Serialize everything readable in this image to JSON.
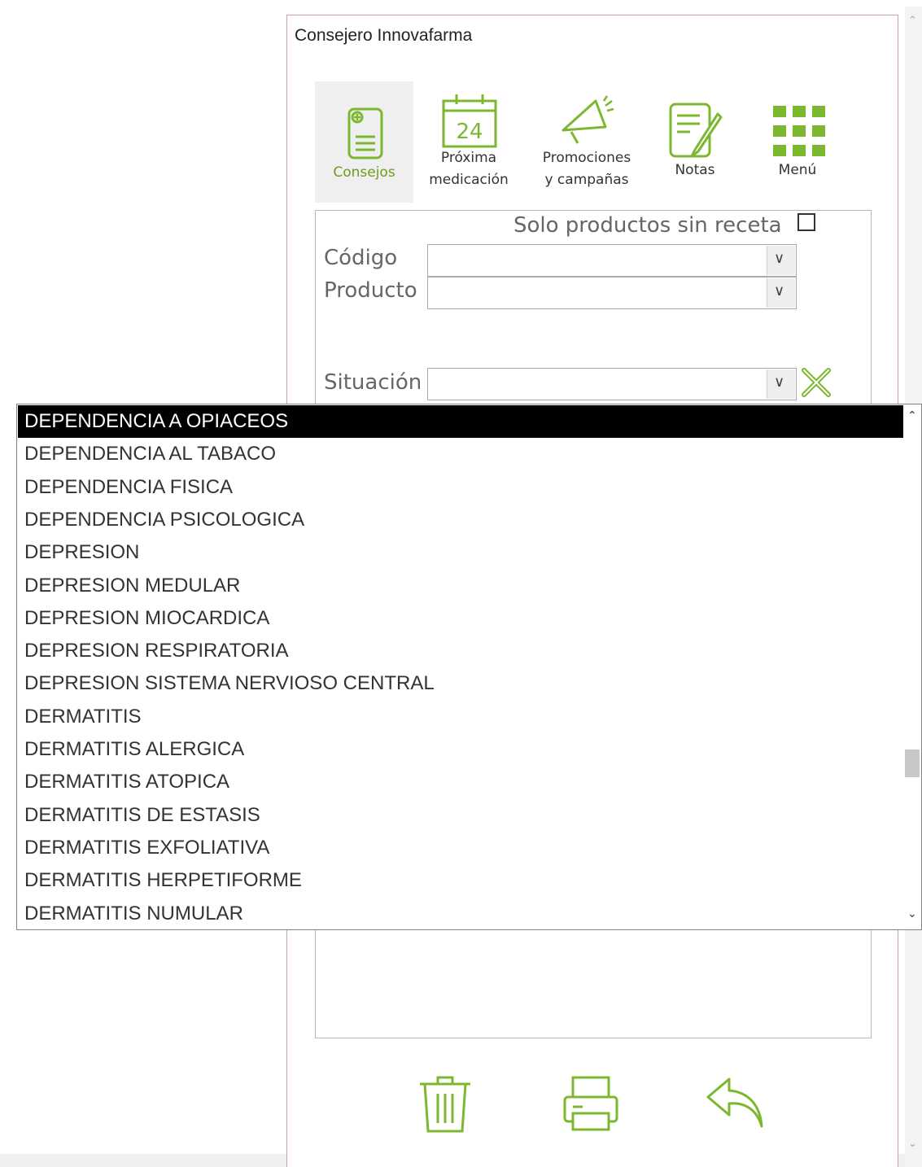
{
  "window": {
    "title": "Consejero Innovafarma"
  },
  "toolbar": {
    "consejos": "Consejos",
    "proxima_line1": "Próxima",
    "proxima_line2": "medicación",
    "calendar_day": "24",
    "promo_line1": "Promociones",
    "promo_line2": "y campañas",
    "notas": "Notas",
    "menu": "Menú"
  },
  "form": {
    "solo_label": "Solo productos sin receta",
    "solo_checked": false,
    "codigo_label": "Código",
    "codigo_value": "",
    "producto_label": "Producto",
    "producto_value": "",
    "situacion_label": "Situación",
    "situacion_value": ""
  },
  "dropdown": {
    "selected_index": 0,
    "items": [
      "DEPENDENCIA A OPIACEOS",
      "DEPENDENCIA AL TABACO",
      "DEPENDENCIA FISICA",
      "DEPENDENCIA PSICOLOGICA",
      "DEPRESION",
      "DEPRESION MEDULAR",
      "DEPRESION MIOCARDICA",
      "DEPRESION RESPIRATORIA",
      "DEPRESION SISTEMA NERVIOSO CENTRAL",
      "DERMATITIS",
      "DERMATITIS ALERGICA",
      "DERMATITIS ATOPICA",
      "DERMATITIS DE ESTASIS",
      "DERMATITIS EXFOLIATIVA",
      "DERMATITIS HERPETIFORME",
      "DERMATITIS NUMULAR"
    ]
  },
  "icons": {
    "consejos": "document-plus-icon",
    "proxima": "calendar-icon",
    "promo": "megaphone-icon",
    "notas": "notes-pencil-icon",
    "menu": "grid-icon",
    "clear": "clear-x-icon",
    "delete": "trash-icon",
    "print": "printer-icon",
    "back": "undo-arrow-icon"
  },
  "colors": {
    "accent": "#7cb82f",
    "selected_bg": "#000000",
    "window_border": "#c9a0b2"
  }
}
